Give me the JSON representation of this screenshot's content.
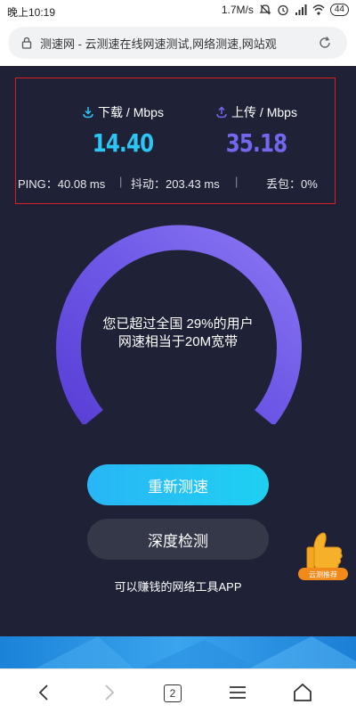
{
  "status_bar": {
    "time": "晚上10:19",
    "network_speed": "1.7M/s",
    "network_type": "HD",
    "battery": "44",
    "icons": [
      "mute-icon",
      "alarm-icon",
      "signal-icon",
      "wifi-icon",
      "battery-icon"
    ]
  },
  "browser": {
    "url_text": "测速网 - 云测速在线网速测试,网络测速,网站观",
    "tab_count": "2"
  },
  "results": {
    "download_label": "下载 / Mbps",
    "download_value": "14.40",
    "upload_label": "上传 / Mbps",
    "upload_value": "35.18",
    "ping": "PING：40.08 ms",
    "jitter": "抖动：203.43 ms",
    "loss": "丢包：0%",
    "separator": "|"
  },
  "gauge": {
    "line1": "您已超过全国 29%的用户",
    "line2": "网速相当于20M宽带"
  },
  "actions": {
    "retest": "重新测速",
    "deep_check": "深度检测",
    "app_link": "可以赚钱的网络工具APP",
    "badge": "云测推荐"
  },
  "colors": {
    "background": "#1f2236",
    "download": "#2cc6f5",
    "upload": "#7367f0",
    "highlight_box": "#d92020"
  }
}
